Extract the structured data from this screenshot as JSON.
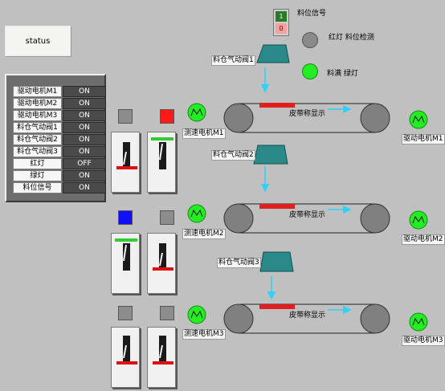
{
  "status": {
    "label": "status"
  },
  "panel": {
    "rows": [
      {
        "name": "驱动电机M1",
        "value": "ON"
      },
      {
        "name": "驱动电机M2",
        "value": "ON"
      },
      {
        "name": "驱动电机M3",
        "value": "ON"
      },
      {
        "name": "料仓气动阀1",
        "value": "ON"
      },
      {
        "name": "料仓气动阀2",
        "value": "ON"
      },
      {
        "name": "料仓气动阀3",
        "value": "ON"
      },
      {
        "name": "红灯",
        "value": "OFF"
      },
      {
        "name": "绿灯",
        "value": "ON"
      },
      {
        "name": "料位信号",
        "value": "ON"
      }
    ]
  },
  "indicator": {
    "on_text": "1",
    "off_text": "0",
    "label": "料位信号"
  },
  "legend": {
    "red_lamp_label": "红灯 料位检测",
    "green_lamp_label": "料满 绿灯"
  },
  "lines": [
    {
      "valve_label": "料仓气动阀1",
      "belt_label": "皮带称显示",
      "speed_motor_label": "测速电机M1",
      "drive_motor_label": "驱动电机M1"
    },
    {
      "valve_label": "料仓气动阀2",
      "belt_label": "皮带称显示",
      "speed_motor_label": "测速电机M2",
      "drive_motor_label": "驱动电机M2"
    },
    {
      "valve_label": "料仓气动阀3",
      "belt_label": "皮带称显示",
      "speed_motor_label": "测速电机M3",
      "drive_motor_label": "驱动电机M3"
    }
  ],
  "colors": {
    "background": "#c0c0c0",
    "lamp_red": "#ff1a1a",
    "lamp_blue": "#1010ff",
    "lamp_gray": "#8c8c8c",
    "motor_green": "#22ee22",
    "valve_teal": "#2a8a8a",
    "flow_cyan": "#30d0ff",
    "belt_red": "#e02020",
    "switch_green": "#33cc33",
    "switch_red": "#e01010"
  }
}
